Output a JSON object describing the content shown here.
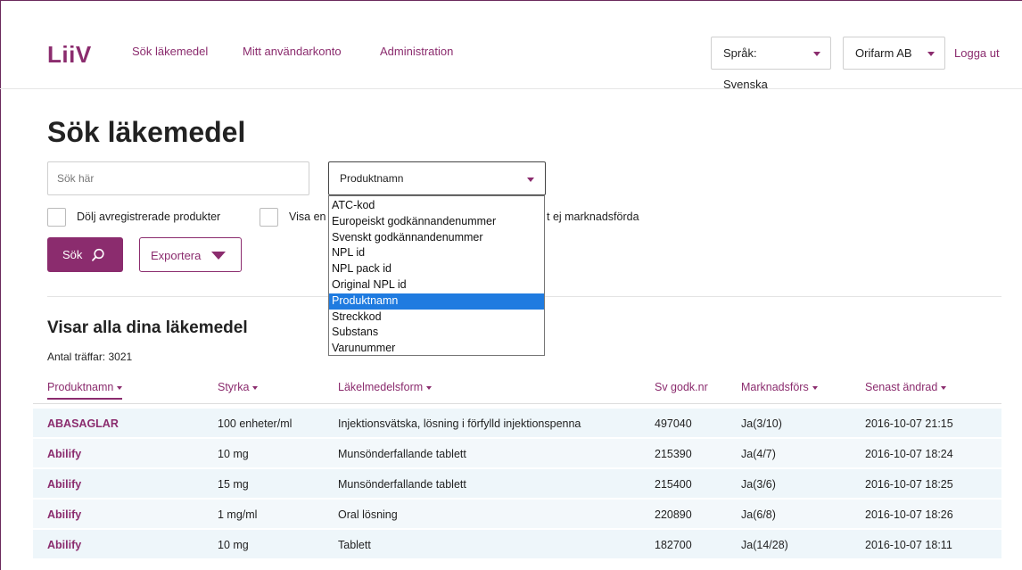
{
  "header": {
    "logo": "LiiV",
    "nav": [
      "Sök läkemedel",
      "Mitt användarkonto",
      "Administration"
    ],
    "language_select": "Språk: Svenska",
    "company_select": "Orifarm AB",
    "logout": "Logga ut"
  },
  "search": {
    "title": "Sök läkemedel",
    "placeholder": "Sök här",
    "field_select": "Produktnamn",
    "options": [
      "ATC-kod",
      "Europeiskt godkännandenummer",
      "Svenskt godkännandenummer",
      "NPL id",
      "NPL pack id",
      "Original NPL id",
      "Produktnamn",
      "Streckkod",
      "Substans",
      "Varunummer"
    ],
    "selected_option": "Produktnamn",
    "checkbox_hide_deregistered": "Dölj avregistrerade produkter",
    "checkbox_show_partial": "Visa en",
    "checkbox_not_marketed": "t ej marknadsförda",
    "search_button": "Sök",
    "export_button": "Exportera"
  },
  "results": {
    "title": "Visar alla dina läkemedel",
    "count": "Antal träffar: 3021",
    "columns": [
      "Produktnamn",
      "Styrka",
      "Läkelmedelsform",
      "Sv godk.nr",
      "Marknadsförs",
      "Senast ändrad"
    ],
    "rows": [
      [
        "ABASAGLAR",
        "100 enheter/ml",
        "Injektionsvätska, lösning i förfylld injektionspenna",
        "497040",
        "Ja(3/10)",
        "2016-10-07 21:15"
      ],
      [
        "Abilify",
        "10 mg",
        "Munsönderfallande tablett",
        "215390",
        "Ja(4/7)",
        "2016-10-07 18:24"
      ],
      [
        "Abilify",
        "15 mg",
        "Munsönderfallande tablett",
        "215400",
        "Ja(3/6)",
        "2016-10-07 18:25"
      ],
      [
        "Abilify",
        "1 mg/ml",
        "Oral lösning",
        "220890",
        "Ja(6/8)",
        "2016-10-07 18:26"
      ],
      [
        "Abilify",
        "10 mg",
        "Tablett",
        "182700",
        "Ja(14/28)",
        "2016-10-07 18:11"
      ]
    ]
  },
  "colors": {
    "brand": "#8b2c6e",
    "row_bg": "#eef6fa",
    "selected_option": "#1f7be0"
  }
}
